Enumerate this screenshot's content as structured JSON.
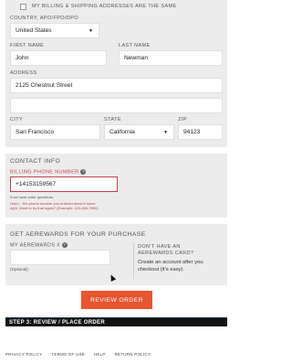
{
  "billing_same": {
    "label": "MY BILLING & SHIPPING ADDRESSES ARE THE SAME",
    "checked": false
  },
  "country": {
    "label": "COUNTRY, APO/FPO/DPO",
    "value": "United States"
  },
  "first_name": {
    "label": "FIRST NAME",
    "value": "John"
  },
  "last_name": {
    "label": "LAST NAME",
    "value": "Newman"
  },
  "address": {
    "label": "ADDRESS",
    "line1": "2125 Chestnut Street",
    "line2": ""
  },
  "city": {
    "label": "CITY",
    "value": "San Francisco"
  },
  "state": {
    "label": "STATE",
    "value": "California"
  },
  "zip": {
    "label": "ZIP",
    "value": "94123"
  },
  "contact": {
    "title": "CONTACT INFO",
    "phone_label": "BILLING PHONE NUMBER",
    "phone_value": "+14153159567",
    "note": "If we have order questions.",
    "error_line1": "Hmm... the phone number you entered doesn't seem",
    "error_line2": "right. Want to try that again? (Example: 123-456-7890)"
  },
  "aerewards": {
    "title": "GET AEREWARDS FOR YOUR PURCHASE",
    "field_label": "MY AEREWARDS #",
    "optional": "(Optional)",
    "no_card_line1": "DON'T HAVE AN",
    "no_card_line2": "AEREWARDS CARD?",
    "create_line1": "Create an account after you",
    "create_line2": "checkout (it's easy)."
  },
  "review_button": "REVIEW ORDER",
  "step3": "STEP 3: REVIEW / PLACE ORDER",
  "footer": [
    "PRIVACY POLICY",
    "TERMS OF USE",
    "HELP",
    "RETURN POLICY"
  ],
  "colors": {
    "accent": "#e8552f",
    "error": "#c6404b",
    "panel": "#ececec",
    "bar": "#111111"
  }
}
